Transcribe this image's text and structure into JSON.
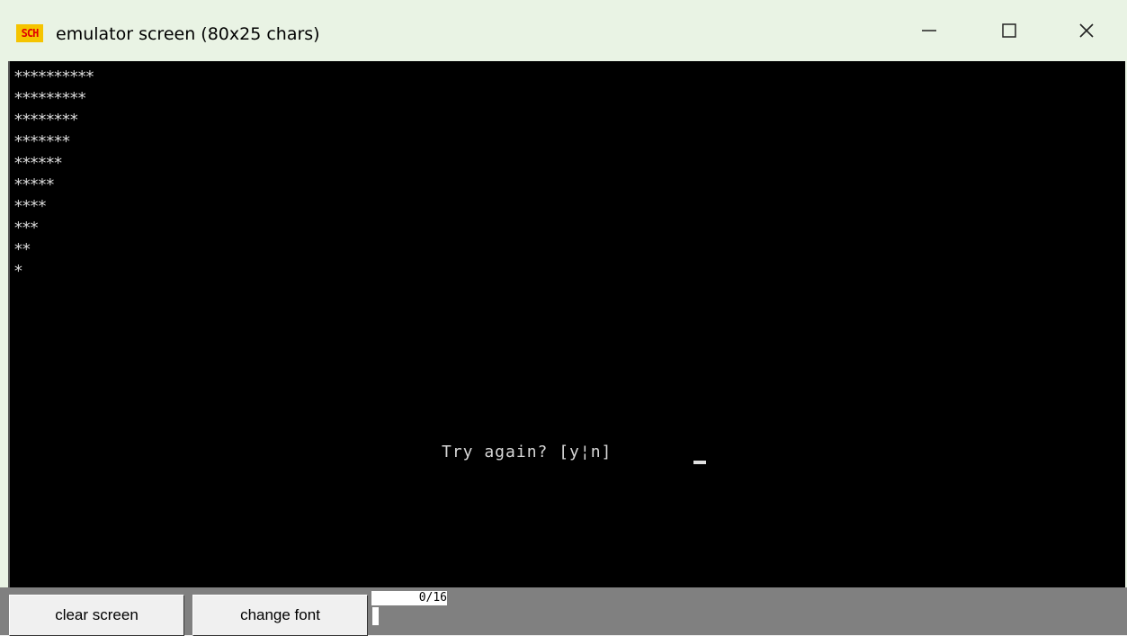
{
  "window": {
    "title": "emulator screen (80x25 chars)",
    "icon": "sch-app-icon",
    "icon_label": "SCH",
    "controls": {
      "minimize": "minimize-icon",
      "maximize": "maximize-icon",
      "close": "close-icon"
    }
  },
  "terminal": {
    "lines": [
      "**********",
      "*********",
      "********",
      "*******",
      "******",
      "*****",
      "****",
      "***",
      "**",
      "*"
    ],
    "prompt": "Try again? [y¦n]",
    "cursor_symbol": "_",
    "colors": {
      "background": "#000000",
      "text": "#d8d8d8"
    }
  },
  "toolbar": {
    "clear_label": "clear screen",
    "font_label": "change font",
    "counter": "0/16"
  }
}
